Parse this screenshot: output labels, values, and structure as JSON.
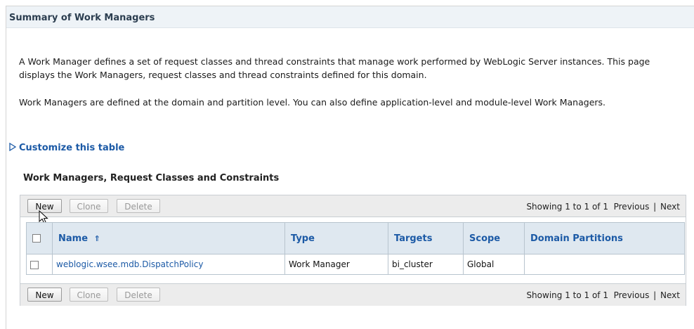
{
  "header": {
    "title": "Summary of Work Managers"
  },
  "description": {
    "p1": "A Work Manager defines a set of request classes and thread constraints that manage work performed by WebLogic Server instances. This page displays the Work Managers, request classes and thread constraints defined for this domain.",
    "p2": "Work Managers are defined at the domain and partition level. You can also define application-level and module-level Work Managers."
  },
  "customize": {
    "label": "Customize this table"
  },
  "table_section": {
    "heading": "Work Managers, Request Classes and Constraints"
  },
  "toolbar": {
    "new_label": "New",
    "clone_label": "Clone",
    "delete_label": "Delete",
    "showing": "Showing 1 to 1 of 1",
    "previous": "Previous",
    "next": "Next",
    "separator": "|"
  },
  "table": {
    "columns": {
      "name": "Name",
      "type": "Type",
      "targets": "Targets",
      "scope": "Scope",
      "domain_partitions": "Domain Partitions"
    },
    "rows": [
      {
        "name": "weblogic.wsee.mdb.DispatchPolicy",
        "type": "Work Manager",
        "targets": "bi_cluster",
        "scope": "Global",
        "domain_partitions": ""
      }
    ]
  },
  "colors": {
    "accent": "#1c5aa6",
    "header_bg": "#eef3f7",
    "table_header_bg": "#dfe8f0"
  }
}
